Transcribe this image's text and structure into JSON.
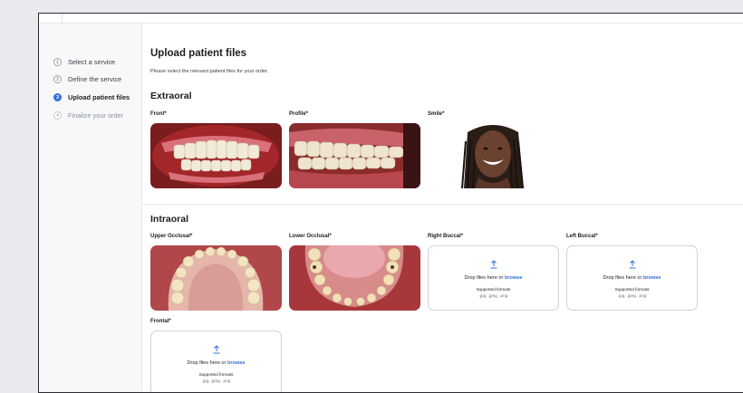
{
  "sidebar": {
    "steps": [
      {
        "number": "1",
        "label": "Select a service",
        "state": "done"
      },
      {
        "number": "2",
        "label": "Define the service",
        "state": "done"
      },
      {
        "number": "3",
        "label": "Upload patient files",
        "state": "active"
      },
      {
        "number": "4",
        "label": "Finalize your order",
        "state": "pending"
      }
    ]
  },
  "main": {
    "title": "Upload patient files",
    "subtitle": "Please select the relevant patient files for your order.",
    "extraoral": {
      "title": "Extraoral",
      "slots": [
        {
          "label": "Front*",
          "state": "uploaded",
          "image": "front-teeth-photo"
        },
        {
          "label": "Profile*",
          "state": "uploaded",
          "image": "profile-teeth-photo"
        },
        {
          "label": "Smile*",
          "state": "uploaded",
          "image": "smile-portrait-photo"
        }
      ]
    },
    "intraoral": {
      "title": "Intraoral",
      "slots": [
        {
          "label": "Upper Occlusal*",
          "state": "uploaded",
          "image": "upper-occlusal-photo"
        },
        {
          "label": "Lower Occlusal*",
          "state": "uploaded",
          "image": "lower-occlusal-photo"
        },
        {
          "label": "Right Buccal*",
          "state": "empty"
        },
        {
          "label": "Left Buccal*",
          "state": "empty"
        },
        {
          "label": "Frontal*",
          "state": "empty"
        }
      ]
    },
    "dropzone": {
      "text": "Drop files here or ",
      "link": "browse",
      "formats_title": "Supported formats",
      "formats": ".jpg, .jpeg, .png",
      "icon": "upload-icon"
    }
  },
  "colors": {
    "accent": "#2f6fe0",
    "border": "#cfd3d8",
    "sidebar_bg": "#f7f8f9"
  }
}
